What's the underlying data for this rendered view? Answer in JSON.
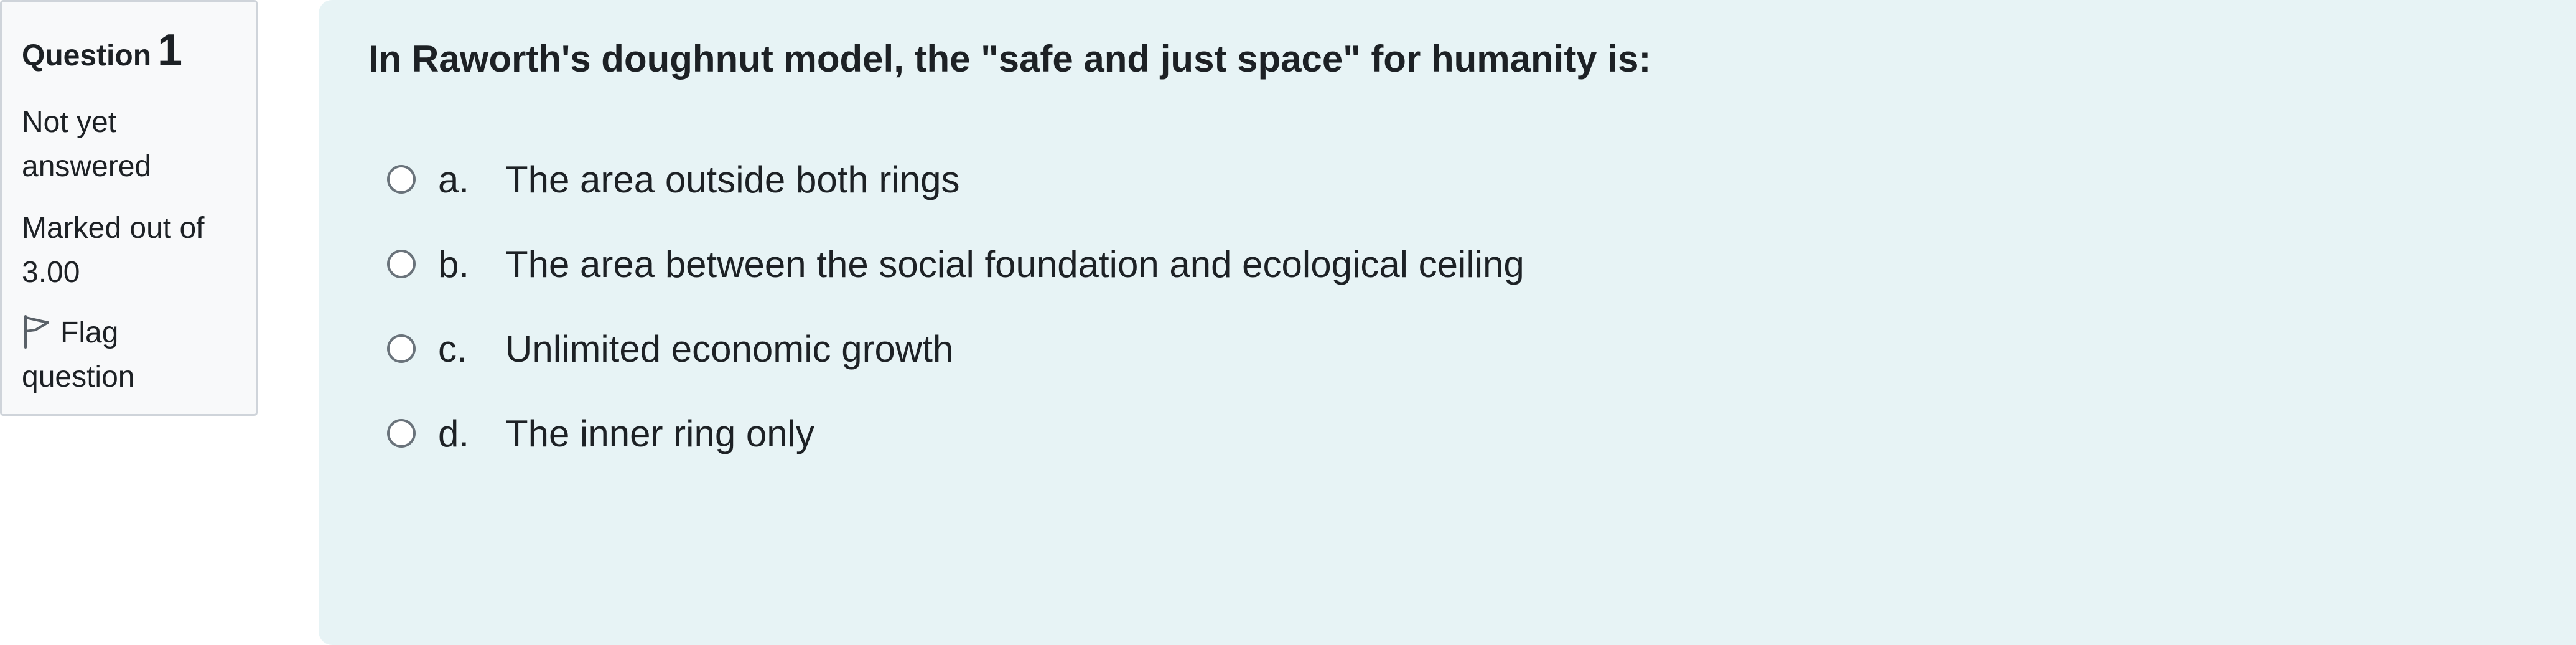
{
  "info": {
    "question_word": "Question",
    "question_number": "1",
    "state": "Not yet answered",
    "grade_label": "Marked out of",
    "grade_value": "3.00",
    "flag_label": "Flag question",
    "flag_icon": "flag-outline-icon"
  },
  "question": {
    "text": "In Raworth's doughnut model, the \"safe and just space\" for humanity is:",
    "answers": [
      {
        "letter": "a.",
        "text": "The area outside both rings"
      },
      {
        "letter": "b.",
        "text": "The area between the social foundation and ecological ceiling"
      },
      {
        "letter": "c.",
        "text": "Unlimited economic growth"
      },
      {
        "letter": "d.",
        "text": "The inner ring only"
      }
    ]
  },
  "colors": {
    "info_background": "#f8f9fa",
    "content_background": "#e7f3f5",
    "text": "#1d2125",
    "border": "#cfd4da"
  }
}
